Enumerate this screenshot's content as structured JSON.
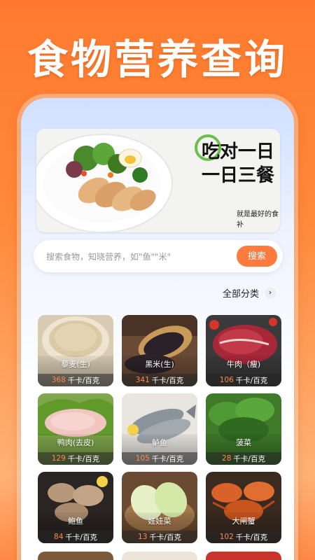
{
  "promo": {
    "title": "食物营养查询"
  },
  "banner": {
    "line1": "吃对一日",
    "line2": "一日三餐",
    "subtitle": "就是最好的食补"
  },
  "search": {
    "placeholder": "搜索食物，知晓营养，如\"鱼\"\"米\"",
    "button": "搜索"
  },
  "category": {
    "all_label": "全部分类"
  },
  "foods": [
    {
      "name": "藜麦(生)",
      "kcal": "368",
      "unit": "千卡/百克"
    },
    {
      "name": "黑米(生)",
      "kcal": "341",
      "unit": "千卡/百克"
    },
    {
      "name": "牛肉（瘦)",
      "kcal": "106",
      "unit": "千卡/百克"
    },
    {
      "name": "鸭肉(去皮)",
      "kcal": "129",
      "unit": "千卡/百克"
    },
    {
      "name": "鲈鱼",
      "kcal": "105",
      "unit": "千卡/百克"
    },
    {
      "name": "菠菜",
      "kcal": "28",
      "unit": "千卡/百克"
    },
    {
      "name": "鲍鱼",
      "kcal": "84",
      "unit": "千卡/百克"
    },
    {
      "name": "娃娃菜",
      "kcal": "13",
      "unit": "千卡/百克"
    },
    {
      "name": "大闸蟹",
      "kcal": "102",
      "unit": "千卡/百克"
    }
  ]
}
